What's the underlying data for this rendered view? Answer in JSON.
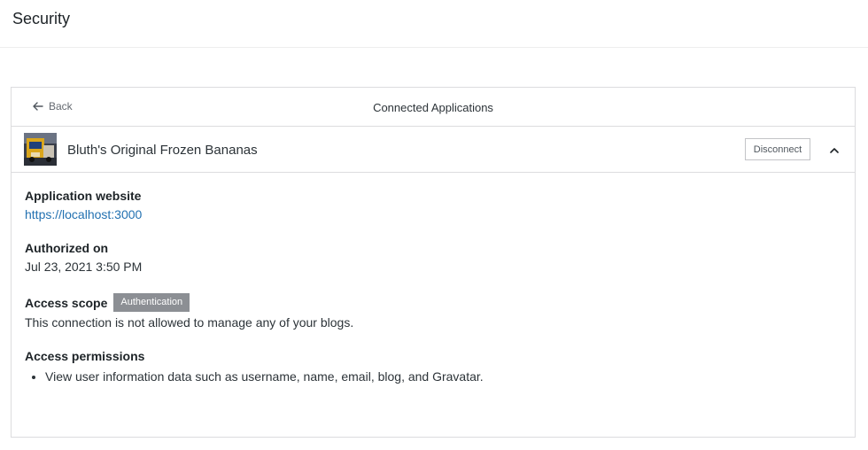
{
  "page": {
    "title": "Security"
  },
  "card": {
    "back_label": "Back",
    "title": "Connected Applications"
  },
  "app": {
    "name": "Bluth's Original Frozen Bananas",
    "disconnect_label": "Disconnect",
    "expanded": true,
    "icon": "app-thumbnail"
  },
  "details": {
    "website_label": "Application website",
    "website_url": "https://localhost:3000",
    "authorized_label": "Authorized on",
    "authorized_value": "Jul 23, 2021 3:50 PM",
    "scope_label": "Access scope",
    "scope_badge": "Authentication",
    "scope_description": "This connection is not allowed to manage any of your blogs.",
    "permissions_label": "Access permissions",
    "permissions": [
      "View user information data such as username, name, email, blog, and Gravatar."
    ]
  },
  "colors": {
    "link": "#2271b1",
    "badge": "#8c8f94",
    "border": "#dcdcde"
  }
}
